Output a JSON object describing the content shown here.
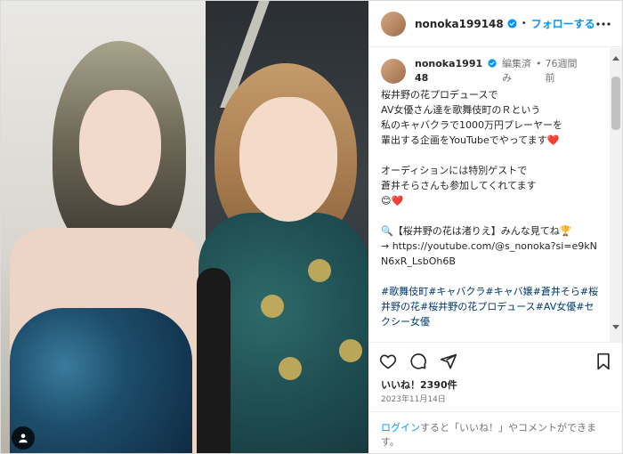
{
  "header": {
    "username": "nonoka199148",
    "separator": "•",
    "follow_label": "フォローする"
  },
  "caption": {
    "username": "nonoka199148",
    "edited": "編集済み",
    "separator": "•",
    "time": "76週間前",
    "lines": [
      "桜井野の花プロデュースで",
      "AV女優さん達を歌舞伎町のＲという",
      "私のキャバクラで1000万円プレーヤーを",
      "輩出する企画をYouTubeでやってます❤️",
      "",
      "オーディションには特別ゲストで",
      "蒼井そらさんも参加してくれてます",
      "😊❤️",
      "",
      "🔍【桜井野の花は渚りえ】みんな見てね🏆",
      "→ https://youtube.com/@s_nonoka?si=e9kNN6xR_LsbOh6B",
      ""
    ],
    "hashtags": "#歌舞伎町#キャバクラ#キャバ嬢#蒼井そら#桜井野の花#桜井野の花プロデュース#AV女優#セクシー女優"
  },
  "stats": {
    "likes": "いいね！2390件",
    "date": "2023年11月14日"
  },
  "login_prompt": {
    "link": "ログイン",
    "text": "すると「いいね！」やコメントができます。"
  },
  "colors": {
    "accent": "#0095f6",
    "verified": "#0095f6",
    "hashtag": "#00376b",
    "muted": "#737373"
  },
  "icons": {
    "verified": "verified-badge-icon",
    "more": "more-options-icon",
    "like": "heart-icon",
    "comment": "comment-icon",
    "share": "share-icon",
    "save": "bookmark-icon",
    "tag": "user-tag-icon"
  }
}
